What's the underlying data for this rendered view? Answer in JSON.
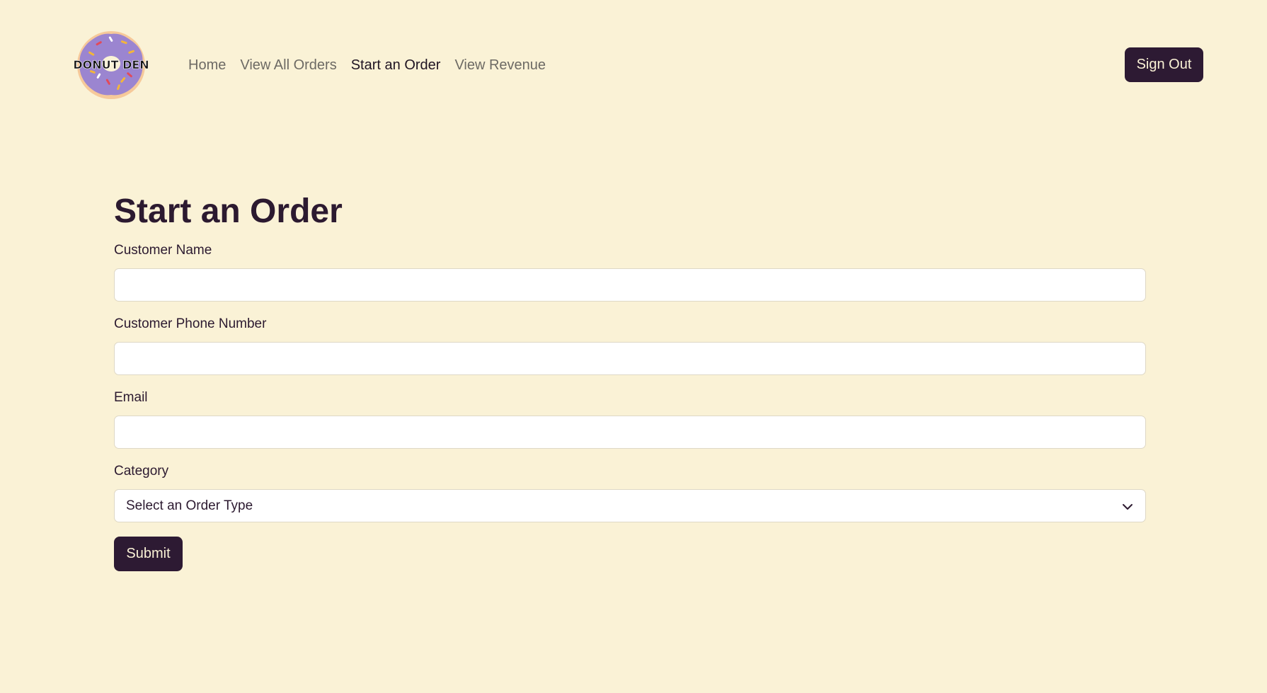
{
  "brand": {
    "logo_text": "DONUT DEN",
    "logo_icon": "donut-logo-icon"
  },
  "nav": {
    "links": [
      {
        "label": "Home",
        "active": false
      },
      {
        "label": "View All Orders",
        "active": false
      },
      {
        "label": "Start an Order",
        "active": true
      },
      {
        "label": "View Revenue",
        "active": false
      }
    ],
    "sign_out_label": "Sign Out"
  },
  "form": {
    "title": "Start an Order",
    "fields": [
      {
        "label": "Customer Name",
        "value": "",
        "placeholder": ""
      },
      {
        "label": "Customer Phone Number",
        "value": "",
        "placeholder": ""
      },
      {
        "label": "Email",
        "value": "",
        "placeholder": ""
      }
    ],
    "category": {
      "label": "Category",
      "selected": "Select an Order Type",
      "icon": "chevron-down-icon"
    },
    "submit_label": "Submit"
  },
  "colors": {
    "background": "#faf2d6",
    "primary": "#2d1a33",
    "donut_glaze": "#9b85d0",
    "donut_dough": "#f6c99a"
  }
}
